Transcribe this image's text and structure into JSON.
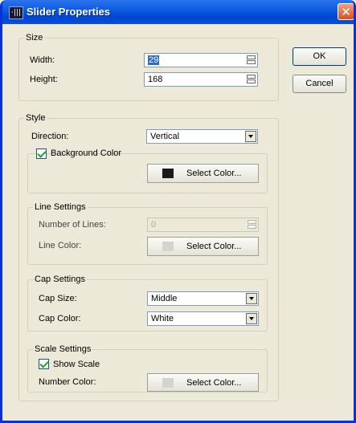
{
  "window": {
    "title": "Slider Properties",
    "app_icon_text": "·|||",
    "close_symbol": "✕"
  },
  "size": {
    "legend": "Size",
    "width_label": "Width:",
    "width_value": "29",
    "height_label": "Height:",
    "height_value": "168"
  },
  "style": {
    "legend": "Style",
    "direction_label": "Direction:",
    "direction_value": "Vertical",
    "background": {
      "label": "Background Color",
      "checked": true,
      "swatch_color": "#1a1a1a",
      "button_label": "Select Color..."
    },
    "line": {
      "legend": "Line Settings",
      "count_label": "Number of Lines:",
      "count_value": "0",
      "color_label": "Line Color:",
      "swatch_color": "#d6d3ce",
      "button_label": "Select Color..."
    },
    "cap": {
      "legend": "Cap Settings",
      "size_label": "Cap Size:",
      "size_value": "Middle",
      "color_label": "Cap Color:",
      "color_value": "White"
    },
    "scale": {
      "legend": "Scale Settings",
      "show_label": "Show Scale",
      "checked": true,
      "number_color_label": "Number Color:",
      "swatch_color": "#d6d3ce",
      "button_label": "Select Color..."
    }
  },
  "buttons": {
    "ok": "OK",
    "cancel": "Cancel"
  }
}
